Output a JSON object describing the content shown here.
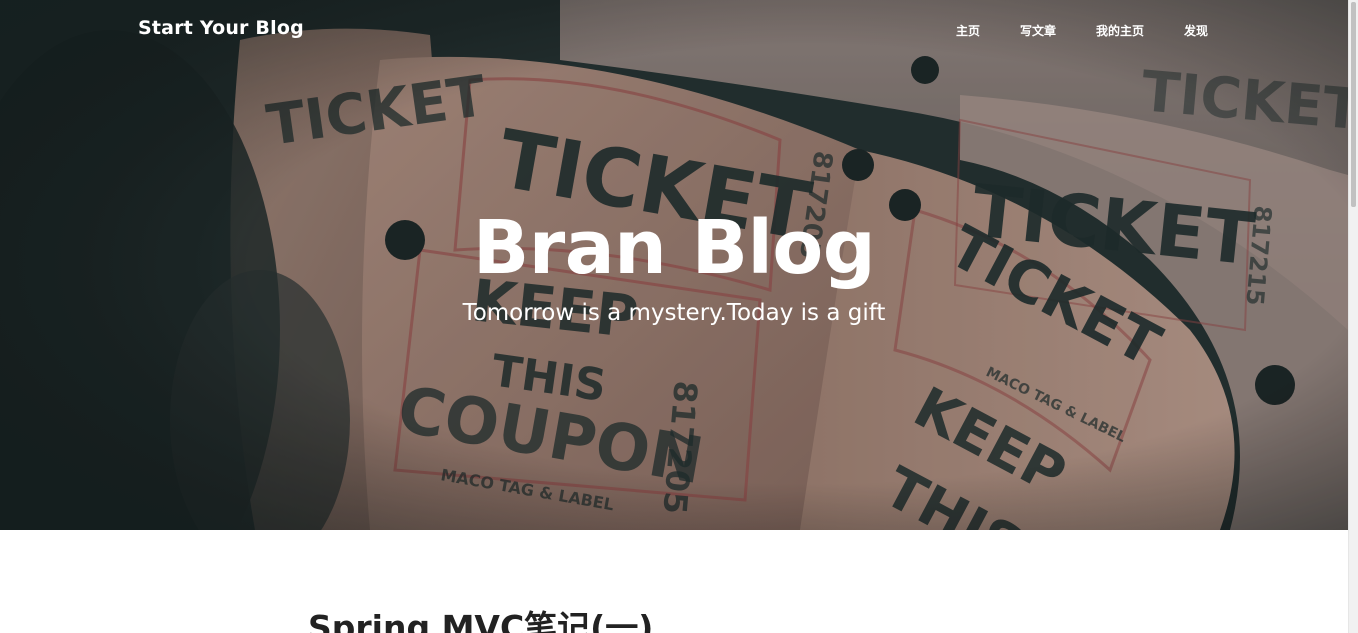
{
  "navbar": {
    "brand": "Start Your Blog",
    "links": [
      {
        "label": "主页"
      },
      {
        "label": "写文章"
      },
      {
        "label": "我的主页"
      },
      {
        "label": "发现"
      }
    ]
  },
  "hero": {
    "title": "Bran Blog",
    "subtitle": "Tomorrow is a mystery.Today is a gift",
    "image_text": {
      "ticket": "TICKET",
      "keep": "KEEP",
      "this": "THIS",
      "coupon": "COUPON",
      "maker": "MACO TAG & LABEL",
      "serial_a": "817205",
      "serial_b": "817215"
    }
  },
  "posts": [
    {
      "title": "Spring MVC笔记(一)"
    }
  ],
  "colors": {
    "hero_dark": "#233030",
    "ticket_paper": "#c9a594",
    "ink": "#1f2e2e",
    "text_dark": "#222222"
  }
}
